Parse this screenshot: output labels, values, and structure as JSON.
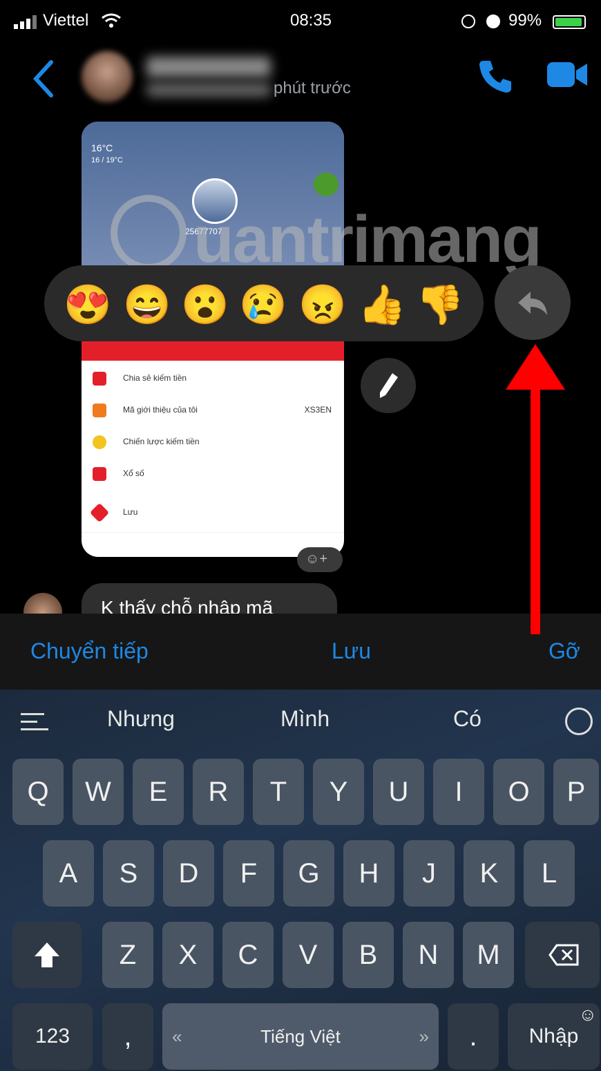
{
  "status_bar": {
    "carrier": "Viettel",
    "time": "08:35",
    "battery": "99%"
  },
  "header": {
    "last_seen": "phút trước"
  },
  "chat": {
    "screenshot": {
      "temperature": "16°C",
      "temperature_range": "16 / 19°C",
      "user_id": "25677707",
      "menu": [
        {
          "label": "Chia sẻ kiếm tiền",
          "right": "",
          "color": "#e3202a"
        },
        {
          "label": "Mã giới thiệu của tôi",
          "right": "XS3EN",
          "color": "#f07b1e"
        },
        {
          "label": "Chiến lược kiếm tiền",
          "right": "",
          "color": "#f2c420"
        },
        {
          "label": "Xổ số",
          "right": "",
          "color": "#e3202a"
        },
        {
          "label": "Lưu",
          "right": "",
          "color": "#e3202a"
        }
      ]
    },
    "reactions": [
      "😍",
      "😄",
      "😮",
      "😢",
      "😠",
      "👍",
      "👎"
    ],
    "message_text": "K thấy chỗ nhập mã",
    "watermark": "uantrimang"
  },
  "actions": {
    "forward": "Chuyển tiếp",
    "save": "Lưu",
    "remove": "Gỡ"
  },
  "keyboard": {
    "suggestions": [
      "Nhưng",
      "Mình",
      "Có"
    ],
    "row1": [
      "Q",
      "W",
      "E",
      "R",
      "T",
      "Y",
      "U",
      "I",
      "O",
      "P"
    ],
    "row2": [
      "A",
      "S",
      "D",
      "F",
      "G",
      "H",
      "J",
      "K",
      "L"
    ],
    "row3": [
      "Z",
      "X",
      "C",
      "V",
      "B",
      "N",
      "M"
    ],
    "numbers_key": "123",
    "comma_key": ",",
    "space_label": "Tiếng Việt",
    "period_key": ".",
    "enter_key": "Nhập"
  },
  "colors": {
    "accent_blue": "#1e88e5",
    "arrow_red": "#ff0000"
  }
}
